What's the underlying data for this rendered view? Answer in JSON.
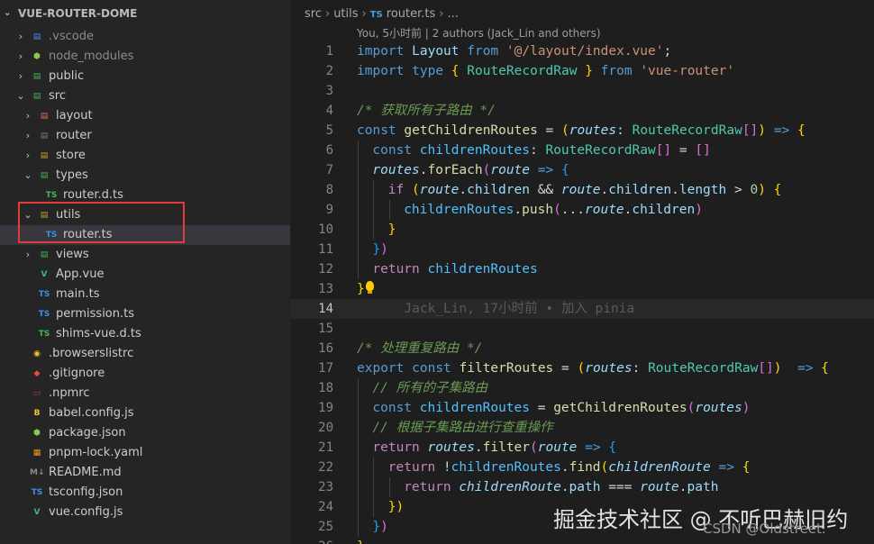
{
  "explorer": {
    "title": "VUE-ROUTER-DOME",
    "items": [
      {
        "label": ".vscode",
        "depth": 0,
        "twisty": ">",
        "icon": "vscode-folder-icon",
        "glyph": "▤",
        "color": "#3b8eea",
        "dim": true
      },
      {
        "label": "node_modules",
        "depth": 0,
        "twisty": ">",
        "icon": "node-folder-icon",
        "glyph": "⬢",
        "color": "#8cc84b",
        "dim": true
      },
      {
        "label": "public",
        "depth": 0,
        "twisty": ">",
        "icon": "public-folder-icon",
        "glyph": "▤",
        "color": "#3fb950"
      },
      {
        "label": "src",
        "depth": 0,
        "twisty": "v",
        "icon": "src-folder-icon",
        "glyph": "▤",
        "color": "#3fb950"
      },
      {
        "label": "layout",
        "depth": 1,
        "twisty": ">",
        "icon": "layout-folder-icon",
        "glyph": "▤",
        "color": "#e06c4c"
      },
      {
        "label": "router",
        "depth": 1,
        "twisty": ">",
        "icon": "router-folder-icon",
        "glyph": "▤",
        "color": "#7a7a7a"
      },
      {
        "label": "store",
        "depth": 1,
        "twisty": ">",
        "icon": "store-folder-icon",
        "glyph": "▤",
        "color": "#c9a227"
      },
      {
        "label": "types",
        "depth": 1,
        "twisty": "v",
        "icon": "types-folder-icon",
        "glyph": "▤",
        "color": "#3fb950"
      },
      {
        "label": "router.d.ts",
        "depth": 2,
        "twisty": "",
        "icon": "typescript-icon",
        "glyph": "TS",
        "color": "#3fb950"
      },
      {
        "label": "utils",
        "depth": 1,
        "twisty": "v",
        "icon": "utils-folder-icon",
        "glyph": "▤",
        "color": "#c9a227"
      },
      {
        "label": "router.ts",
        "depth": 2,
        "twisty": "",
        "icon": "typescript-icon",
        "glyph": "TS",
        "color": "#3b8eea",
        "selected": true
      },
      {
        "label": "views",
        "depth": 1,
        "twisty": ">",
        "icon": "views-folder-icon",
        "glyph": "▤",
        "color": "#3fb950"
      },
      {
        "label": "App.vue",
        "depth": 1,
        "twisty": "",
        "icon": "vue-icon",
        "glyph": "V",
        "color": "#41b883"
      },
      {
        "label": "main.ts",
        "depth": 1,
        "twisty": "",
        "icon": "typescript-icon",
        "glyph": "TS",
        "color": "#3b8eea"
      },
      {
        "label": "permission.ts",
        "depth": 1,
        "twisty": "",
        "icon": "typescript-icon",
        "glyph": "TS",
        "color": "#3b8eea"
      },
      {
        "label": "shims-vue.d.ts",
        "depth": 1,
        "twisty": "",
        "icon": "typescript-icon",
        "glyph": "TS",
        "color": "#3fb950"
      },
      {
        "label": ".browserslistrc",
        "depth": 0,
        "twisty": "",
        "icon": "browserslist-icon",
        "glyph": "◉",
        "color": "#f5c518"
      },
      {
        "label": ".gitignore",
        "depth": 0,
        "twisty": "",
        "icon": "git-icon",
        "glyph": "◆",
        "color": "#e8512f"
      },
      {
        "label": ".npmrc",
        "depth": 0,
        "twisty": "",
        "icon": "npm-icon",
        "glyph": "▭",
        "color": "#c23b3b"
      },
      {
        "label": "babel.config.js",
        "depth": 0,
        "twisty": "",
        "icon": "babel-icon",
        "glyph": "B",
        "color": "#f0c33c"
      },
      {
        "label": "package.json",
        "depth": 0,
        "twisty": "",
        "icon": "nodejs-icon",
        "glyph": "⬢",
        "color": "#8cc84b"
      },
      {
        "label": "pnpm-lock.yaml",
        "depth": 0,
        "twisty": "",
        "icon": "pnpm-icon",
        "glyph": "▦",
        "color": "#f69220"
      },
      {
        "label": "README.md",
        "depth": 0,
        "twisty": "",
        "icon": "markdown-icon",
        "glyph": "M↓",
        "color": "#8a8a8a"
      },
      {
        "label": "tsconfig.json",
        "depth": 0,
        "twisty": "",
        "icon": "tsconfig-icon",
        "glyph": "TS",
        "color": "#3b8eea"
      },
      {
        "label": "vue.config.js",
        "depth": 0,
        "twisty": "",
        "icon": "vue-config-icon",
        "glyph": "V",
        "color": "#41b883"
      }
    ]
  },
  "editor": {
    "breadcrumb": {
      "parts": [
        "src",
        "utils"
      ],
      "file_icon": "TS",
      "file": "router.ts",
      "trailing": "..."
    },
    "blame_header": "You, 5小时前 | 2 authors (Jack_Lin and others)",
    "current_line": 14,
    "lines": [
      {
        "n": "1",
        "indent": 0,
        "tokens": [
          [
            "kw",
            "import"
          ],
          [
            "pu",
            " "
          ],
          [
            "vr",
            "Layout"
          ],
          [
            "pu",
            " "
          ],
          [
            "kw",
            "from"
          ],
          [
            "pu",
            " "
          ],
          [
            "str",
            "'@/layout/index.vue'"
          ],
          [
            "pu",
            ";"
          ]
        ]
      },
      {
        "n": "2",
        "indent": 0,
        "tokens": [
          [
            "kw",
            "import"
          ],
          [
            "pu",
            " "
          ],
          [
            "kw",
            "type"
          ],
          [
            "pu",
            " "
          ],
          [
            "br1",
            "{"
          ],
          [
            "pu",
            " "
          ],
          [
            "ty",
            "RouteRecordRaw"
          ],
          [
            "pu",
            " "
          ],
          [
            "br1",
            "}"
          ],
          [
            "pu",
            " "
          ],
          [
            "kw",
            "from"
          ],
          [
            "pu",
            " "
          ],
          [
            "str",
            "'vue-router'"
          ]
        ]
      },
      {
        "n": "3",
        "indent": 0,
        "tokens": []
      },
      {
        "n": "4",
        "indent": 0,
        "tokens": [
          [
            "cm",
            "/* 获取所有子路由 */"
          ]
        ]
      },
      {
        "n": "5",
        "indent": 0,
        "tokens": [
          [
            "kw",
            "const"
          ],
          [
            "pu",
            " "
          ],
          [
            "fn",
            "getChildrenRoutes"
          ],
          [
            "pu",
            " = "
          ],
          [
            "br1",
            "("
          ],
          [
            "par",
            "routes"
          ],
          [
            "pu",
            ": "
          ],
          [
            "ty",
            "RouteRecordRaw"
          ],
          [
            "br2",
            "[]"
          ],
          [
            "br1",
            ")"
          ],
          [
            "pu",
            " "
          ],
          [
            "kw",
            "=>"
          ],
          [
            "pu",
            " "
          ],
          [
            "br1",
            "{"
          ]
        ]
      },
      {
        "n": "6",
        "indent": 1,
        "tokens": [
          [
            "kw",
            "const"
          ],
          [
            "pu",
            " "
          ],
          [
            "cst",
            "childrenRoutes"
          ],
          [
            "pu",
            ": "
          ],
          [
            "ty",
            "RouteRecordRaw"
          ],
          [
            "br2",
            "[]"
          ],
          [
            "pu",
            " = "
          ],
          [
            "br2",
            "[]"
          ]
        ]
      },
      {
        "n": "7",
        "indent": 1,
        "tokens": [
          [
            "par",
            "routes"
          ],
          [
            "pu",
            "."
          ],
          [
            "fn",
            "forEach"
          ],
          [
            "br2",
            "("
          ],
          [
            "par",
            "route"
          ],
          [
            "pu",
            " "
          ],
          [
            "kw",
            "=>"
          ],
          [
            "pu",
            " "
          ],
          [
            "br3",
            "{"
          ]
        ]
      },
      {
        "n": "8",
        "indent": 2,
        "tokens": [
          [
            "ctl",
            "if"
          ],
          [
            "pu",
            " "
          ],
          [
            "br1",
            "("
          ],
          [
            "par",
            "route"
          ],
          [
            "pu",
            "."
          ],
          [
            "prop",
            "children"
          ],
          [
            "pu",
            " && "
          ],
          [
            "par",
            "route"
          ],
          [
            "pu",
            "."
          ],
          [
            "prop",
            "children"
          ],
          [
            "pu",
            "."
          ],
          [
            "prop",
            "length"
          ],
          [
            "pu",
            " > "
          ],
          [
            "num",
            "0"
          ],
          [
            "br1",
            ")"
          ],
          [
            "pu",
            " "
          ],
          [
            "br1",
            "{"
          ]
        ]
      },
      {
        "n": "9",
        "indent": 3,
        "tokens": [
          [
            "cst",
            "childrenRoutes"
          ],
          [
            "pu",
            "."
          ],
          [
            "fn",
            "push"
          ],
          [
            "br2",
            "("
          ],
          [
            "pu",
            "..."
          ],
          [
            "par",
            "route"
          ],
          [
            "pu",
            "."
          ],
          [
            "prop",
            "children"
          ],
          [
            "br2",
            ")"
          ]
        ]
      },
      {
        "n": "10",
        "indent": 2,
        "tokens": [
          [
            "br1",
            "}"
          ]
        ]
      },
      {
        "n": "11",
        "indent": 1,
        "tokens": [
          [
            "br3",
            "}"
          ],
          [
            "br2",
            ")"
          ]
        ]
      },
      {
        "n": "12",
        "indent": 1,
        "tokens": [
          [
            "ctl",
            "return"
          ],
          [
            "pu",
            " "
          ],
          [
            "cst",
            "childrenRoutes"
          ]
        ]
      },
      {
        "n": "13",
        "indent": 0,
        "tokens": [
          [
            "br1",
            "}"
          ]
        ],
        "bulb": true
      },
      {
        "n": "14",
        "indent": 0,
        "tokens": [
          [
            "blame",
            "      Jack_Lin, 17小时前 • 加入 pinia"
          ]
        ]
      },
      {
        "n": "15",
        "indent": 0,
        "tokens": []
      },
      {
        "n": "16",
        "indent": 0,
        "tokens": [
          [
            "cm",
            "/* 处理重复路由 */"
          ]
        ]
      },
      {
        "n": "17",
        "indent": 0,
        "tokens": [
          [
            "kw",
            "export"
          ],
          [
            "pu",
            " "
          ],
          [
            "kw",
            "const"
          ],
          [
            "pu",
            " "
          ],
          [
            "fn",
            "filterRoutes"
          ],
          [
            "pu",
            " = "
          ],
          [
            "br1",
            "("
          ],
          [
            "par",
            "routes"
          ],
          [
            "pu",
            ": "
          ],
          [
            "ty",
            "RouteRecordRaw"
          ],
          [
            "br2",
            "[]"
          ],
          [
            "br1",
            ")"
          ],
          [
            "pu",
            "  "
          ],
          [
            "kw",
            "=>"
          ],
          [
            "pu",
            " "
          ],
          [
            "br1",
            "{"
          ]
        ]
      },
      {
        "n": "18",
        "indent": 1,
        "tokens": [
          [
            "cm",
            "// 所有的子集路由"
          ]
        ]
      },
      {
        "n": "19",
        "indent": 1,
        "tokens": [
          [
            "kw",
            "const"
          ],
          [
            "pu",
            " "
          ],
          [
            "cst",
            "childrenRoutes"
          ],
          [
            "pu",
            " = "
          ],
          [
            "fn",
            "getChildrenRoutes"
          ],
          [
            "br2",
            "("
          ],
          [
            "par",
            "routes"
          ],
          [
            "br2",
            ")"
          ]
        ]
      },
      {
        "n": "20",
        "indent": 1,
        "tokens": [
          [
            "cm",
            "// 根据子集路由进行查重操作"
          ]
        ]
      },
      {
        "n": "21",
        "indent": 1,
        "tokens": [
          [
            "ctl",
            "return"
          ],
          [
            "pu",
            " "
          ],
          [
            "par",
            "routes"
          ],
          [
            "pu",
            "."
          ],
          [
            "fn",
            "filter"
          ],
          [
            "br2",
            "("
          ],
          [
            "par",
            "route"
          ],
          [
            "pu",
            " "
          ],
          [
            "kw",
            "=>"
          ],
          [
            "pu",
            " "
          ],
          [
            "br3",
            "{"
          ]
        ]
      },
      {
        "n": "22",
        "indent": 2,
        "tokens": [
          [
            "ctl",
            "return"
          ],
          [
            "pu",
            " !"
          ],
          [
            "cst",
            "childrenRoutes"
          ],
          [
            "pu",
            "."
          ],
          [
            "fn",
            "find"
          ],
          [
            "br1",
            "("
          ],
          [
            "par",
            "childrenRoute"
          ],
          [
            "pu",
            " "
          ],
          [
            "kw",
            "=>"
          ],
          [
            "pu",
            " "
          ],
          [
            "br1",
            "{"
          ]
        ]
      },
      {
        "n": "23",
        "indent": 3,
        "tokens": [
          [
            "ctl",
            "return"
          ],
          [
            "pu",
            " "
          ],
          [
            "par",
            "childrenRoute"
          ],
          [
            "pu",
            "."
          ],
          [
            "prop",
            "path"
          ],
          [
            "pu",
            " === "
          ],
          [
            "par",
            "route"
          ],
          [
            "pu",
            "."
          ],
          [
            "prop",
            "path"
          ]
        ]
      },
      {
        "n": "24",
        "indent": 2,
        "tokens": [
          [
            "br1",
            "}"
          ],
          [
            "br1",
            ")"
          ]
        ]
      },
      {
        "n": "25",
        "indent": 1,
        "tokens": [
          [
            "br3",
            "}"
          ],
          [
            "br2",
            ")"
          ]
        ]
      },
      {
        "n": "26",
        "indent": 0,
        "tokens": [
          [
            "br1",
            "}"
          ]
        ]
      }
    ]
  },
  "watermark": "掘金技术社区 @ 不听巴赫旧约",
  "csdn_mark": "CSDN @Oldstreet."
}
